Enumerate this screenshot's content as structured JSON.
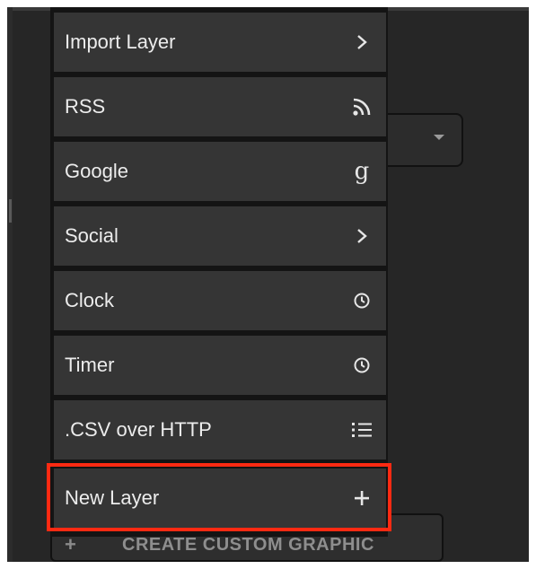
{
  "menu": {
    "items": [
      {
        "label": "Import Layer",
        "icon": "chevron-right-icon"
      },
      {
        "label": "RSS",
        "icon": "rss-icon"
      },
      {
        "label": "Google",
        "icon": "google-g-icon"
      },
      {
        "label": "Social",
        "icon": "chevron-right-icon"
      },
      {
        "label": "Clock",
        "icon": "clock-icon"
      },
      {
        "label": "Timer",
        "icon": "clock-icon"
      },
      {
        "label": ".CSV over HTTP",
        "icon": "list-icon"
      },
      {
        "label": "New Layer",
        "icon": "plus-icon",
        "highlighted": true
      }
    ]
  },
  "create_button": {
    "label": "CREATE CUSTOM GRAPHIC",
    "icon": "plus-icon"
  },
  "colors": {
    "background": "#262626",
    "menu_item": "#353535",
    "menu_text": "#ececec",
    "highlight": "#ff2a12"
  }
}
